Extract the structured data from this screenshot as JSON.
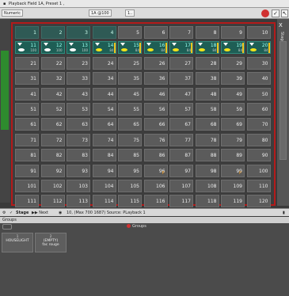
{
  "titlebar": {
    "title": "Playback Field 1A, Preset 1 ,",
    "icon": "window-icon"
  },
  "toolbar": {
    "mode_label": "Numeric",
    "field_label": "1A @100",
    "field2_label": "1..",
    "buttons": [
      "record-icon",
      "check-icon",
      "pointer-icon"
    ]
  },
  "grid": {
    "cells": [
      {
        "n": "1",
        "state": "dark"
      },
      {
        "n": "2",
        "state": "dark"
      },
      {
        "n": "3",
        "state": "dark"
      },
      {
        "n": "4",
        "state": "dark"
      },
      {
        "n": "5",
        "state": "normal"
      },
      {
        "n": "6",
        "state": "normal"
      },
      {
        "n": "7",
        "state": "normal"
      },
      {
        "n": "8",
        "state": "normal"
      },
      {
        "n": "9",
        "state": "normal"
      },
      {
        "n": "10",
        "state": "normal"
      },
      {
        "n": "11",
        "state": "lit",
        "dot": "white",
        "pct": "100"
      },
      {
        "n": "12",
        "state": "lit",
        "dot": "white",
        "pct": "100"
      },
      {
        "n": "13",
        "state": "lit",
        "dot": "white",
        "pct": "100"
      },
      {
        "n": "14",
        "state": "lit",
        "dot": "yellow",
        "pct": "84"
      },
      {
        "n": "15",
        "state": "lit",
        "dot": "yellow",
        "pct": "84"
      },
      {
        "n": "16",
        "state": "lit",
        "dot": "yellow",
        "pct": "84"
      },
      {
        "n": "17",
        "state": "lit",
        "dot": "yellow",
        "pct": "84"
      },
      {
        "n": "18",
        "state": "lit",
        "dot": "yellow",
        "pct": "84"
      },
      {
        "n": "19",
        "state": "lit",
        "dot": "yellow",
        "pct": "84"
      },
      {
        "n": "20",
        "state": "lit",
        "dot": "yellow",
        "pct": "84"
      },
      {
        "n": "21"
      },
      {
        "n": "22"
      },
      {
        "n": "23"
      },
      {
        "n": "24"
      },
      {
        "n": "25"
      },
      {
        "n": "26"
      },
      {
        "n": "27"
      },
      {
        "n": "28"
      },
      {
        "n": "29"
      },
      {
        "n": "30"
      },
      {
        "n": "31"
      },
      {
        "n": "32"
      },
      {
        "n": "33"
      },
      {
        "n": "34"
      },
      {
        "n": "35"
      },
      {
        "n": "36"
      },
      {
        "n": "37"
      },
      {
        "n": "38"
      },
      {
        "n": "39"
      },
      {
        "n": "40"
      },
      {
        "n": "41"
      },
      {
        "n": "42"
      },
      {
        "n": "43"
      },
      {
        "n": "44"
      },
      {
        "n": "45"
      },
      {
        "n": "46"
      },
      {
        "n": "47"
      },
      {
        "n": "48"
      },
      {
        "n": "49"
      },
      {
        "n": "50"
      },
      {
        "n": "51"
      },
      {
        "n": "52"
      },
      {
        "n": "53"
      },
      {
        "n": "54"
      },
      {
        "n": "55"
      },
      {
        "n": "56"
      },
      {
        "n": "57"
      },
      {
        "n": "58"
      },
      {
        "n": "59"
      },
      {
        "n": "60"
      },
      {
        "n": "61"
      },
      {
        "n": "62"
      },
      {
        "n": "63"
      },
      {
        "n": "64"
      },
      {
        "n": "65"
      },
      {
        "n": "66"
      },
      {
        "n": "67"
      },
      {
        "n": "68"
      },
      {
        "n": "69"
      },
      {
        "n": "70"
      },
      {
        "n": "71"
      },
      {
        "n": "72"
      },
      {
        "n": "73"
      },
      {
        "n": "74"
      },
      {
        "n": "75"
      },
      {
        "n": "76"
      },
      {
        "n": "77"
      },
      {
        "n": "78"
      },
      {
        "n": "79"
      },
      {
        "n": "80"
      },
      {
        "n": "81"
      },
      {
        "n": "82"
      },
      {
        "n": "83"
      },
      {
        "n": "84"
      },
      {
        "n": "85"
      },
      {
        "n": "86"
      },
      {
        "n": "87"
      },
      {
        "n": "88"
      },
      {
        "n": "89"
      },
      {
        "n": "90"
      },
      {
        "n": "91"
      },
      {
        "n": "92"
      },
      {
        "n": "93"
      },
      {
        "n": "94"
      },
      {
        "n": "95"
      },
      {
        "n": "96",
        "mark": "P"
      },
      {
        "n": "97"
      },
      {
        "n": "98"
      },
      {
        "n": "99",
        "mark": "P"
      },
      {
        "n": "100"
      },
      {
        "n": "101"
      },
      {
        "n": "102"
      },
      {
        "n": "103"
      },
      {
        "n": "104"
      },
      {
        "n": "105"
      },
      {
        "n": "106"
      },
      {
        "n": "107"
      },
      {
        "n": "108"
      },
      {
        "n": "109"
      },
      {
        "n": "110"
      },
      {
        "n": "111"
      },
      {
        "n": "112"
      },
      {
        "n": "113"
      },
      {
        "n": "114"
      },
      {
        "n": "115"
      },
      {
        "n": "116"
      },
      {
        "n": "117"
      },
      {
        "n": "118"
      },
      {
        "n": "119"
      },
      {
        "n": "120"
      }
    ]
  },
  "right_panel": {
    "close": "X",
    "label": "Stage"
  },
  "statusbar": {
    "stage": "Stage",
    "next": "Next",
    "info": "10, (Max 700 1687) Source: PLayback 1"
  },
  "groups": {
    "title": "Groups",
    "header": "Groups",
    "tiles": [
      {
        "num": "1",
        "label": "HOUSELIGHT"
      },
      {
        "num": "2",
        "label": "(EMPTY)",
        "sub": "fac rouge"
      }
    ]
  },
  "colors": {
    "frame": "#b41a1a",
    "lit": "#1e5e55",
    "dot_yellow": "#f2e21a",
    "accent_green": "#2e8b2e"
  }
}
